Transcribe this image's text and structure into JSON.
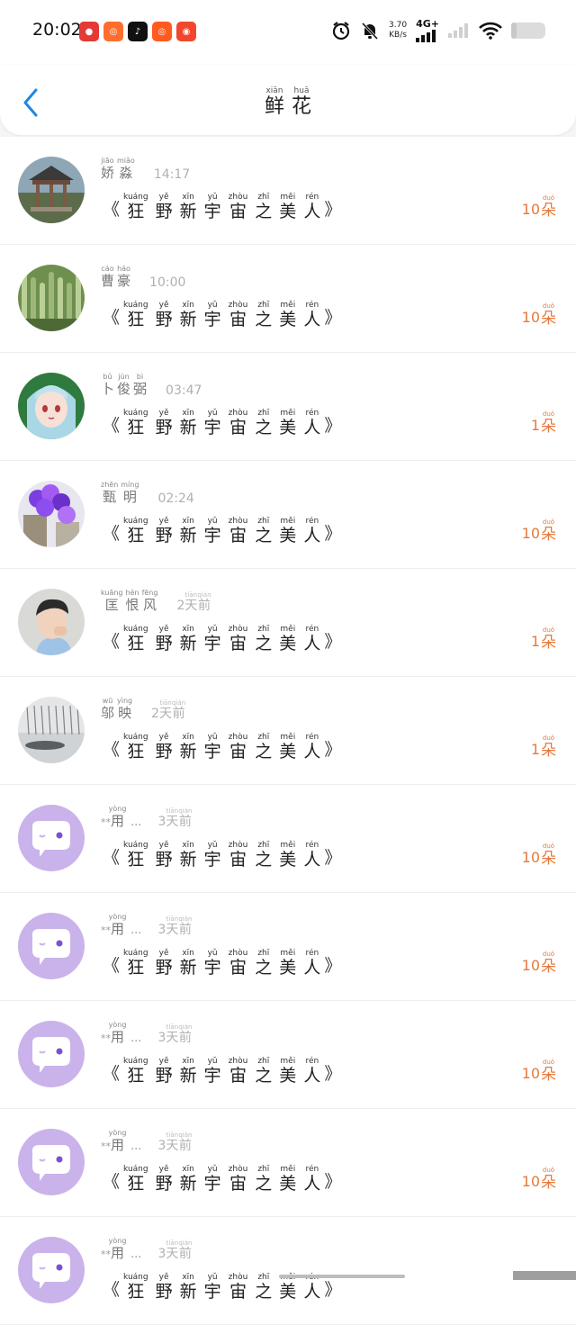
{
  "status": {
    "time": "20:02",
    "net_speed_top": "3.70",
    "net_speed_bottom": "KB/s",
    "network": "4G+",
    "battery_level": 0.15
  },
  "header": {
    "title": [
      {
        "char": "鲜",
        "py": "xiān"
      },
      {
        "char": "花",
        "py": "huā"
      }
    ]
  },
  "colors": {
    "accent": "#1e88e5",
    "count": "#e67a3c",
    "avatar_default": "#c9b3ea"
  },
  "message_prefix": "《",
  "message_suffix": "》",
  "message": [
    {
      "char": "狂",
      "py": "kuáng"
    },
    {
      "char": "野",
      "py": "yě"
    },
    {
      "char": "新",
      "py": "xīn"
    },
    {
      "char": "宇",
      "py": "yǔ"
    },
    {
      "char": "宙",
      "py": "zhòu"
    },
    {
      "char": "之",
      "py": "zhī"
    },
    {
      "char": "美",
      "py": "měi"
    },
    {
      "char": "人",
      "py": "rén"
    }
  ],
  "unit": {
    "char": "朵",
    "py": "duǒ"
  },
  "items": [
    {
      "avatar": "pavilion",
      "name": [
        {
          "char": "娇",
          "py": "jiāo"
        },
        {
          "char": "淼",
          "py": "miǎo"
        }
      ],
      "time_text": "14:17",
      "count": "10"
    },
    {
      "avatar": "cactus",
      "name": [
        {
          "char": "曹",
          "py": "cáo"
        },
        {
          "char": "豪",
          "py": "háo"
        }
      ],
      "time_text": "10:00",
      "count": "10"
    },
    {
      "avatar": "anime",
      "name": [
        {
          "char": "卜",
          "py": "bǔ"
        },
        {
          "char": "俊",
          "py": "jùn"
        },
        {
          "char": "弼",
          "py": "bì"
        }
      ],
      "time_text": "03:47",
      "count": "1"
    },
    {
      "avatar": "flowers",
      "name": [
        {
          "char": "甄",
          "py": "zhēn"
        },
        {
          "char": "明",
          "py": "míng"
        }
      ],
      "time_text": "02:24",
      "count": "10"
    },
    {
      "avatar": "person",
      "name": [
        {
          "char": "匡",
          "py": "kuāng"
        },
        {
          "char": "恨",
          "py": "hèn"
        },
        {
          "char": "风",
          "py": "fēng"
        }
      ],
      "time_num": "2",
      "time_text": "",
      "time_ago": [
        {
          "char": "天",
          "py": "tiān"
        },
        {
          "char": "前",
          "py": "qián"
        }
      ],
      "count": "1"
    },
    {
      "avatar": "snow",
      "name": [
        {
          "char": "邬",
          "py": "wū"
        },
        {
          "char": "映",
          "py": "yìng"
        }
      ],
      "time_num": "2",
      "time_text": "",
      "time_ago": [
        {
          "char": "天",
          "py": "tiān"
        },
        {
          "char": "前",
          "py": "qián"
        }
      ],
      "count": "1"
    },
    {
      "avatar": "default",
      "name_prefix": "**",
      "name": [
        {
          "char": "用",
          "py": "yòng"
        }
      ],
      "name_suffix": "...",
      "time_num": "3",
      "time_text": "",
      "time_ago": [
        {
          "char": "天",
          "py": "tiān"
        },
        {
          "char": "前",
          "py": "qián"
        }
      ],
      "count": "10"
    },
    {
      "avatar": "default",
      "name_prefix": "**",
      "name": [
        {
          "char": "用",
          "py": "yòng"
        }
      ],
      "name_suffix": "...",
      "time_num": "3",
      "time_text": "",
      "time_ago": [
        {
          "char": "天",
          "py": "tiān"
        },
        {
          "char": "前",
          "py": "qián"
        }
      ],
      "count": "10"
    },
    {
      "avatar": "default",
      "name_prefix": "**",
      "name": [
        {
          "char": "用",
          "py": "yòng"
        }
      ],
      "name_suffix": "...",
      "time_num": "3",
      "time_text": "",
      "time_ago": [
        {
          "char": "天",
          "py": "tiān"
        },
        {
          "char": "前",
          "py": "qián"
        }
      ],
      "count": "10"
    },
    {
      "avatar": "default",
      "name_prefix": "**",
      "name": [
        {
          "char": "用",
          "py": "yòng"
        }
      ],
      "name_suffix": "...",
      "time_num": "3",
      "time_text": "",
      "time_ago": [
        {
          "char": "天",
          "py": "tiān"
        },
        {
          "char": "前",
          "py": "qián"
        }
      ],
      "count": "10"
    },
    {
      "avatar": "default",
      "name_prefix": "**",
      "name": [
        {
          "char": "用",
          "py": "yòng"
        }
      ],
      "name_suffix": "...",
      "time_num": "3",
      "time_text": "",
      "time_ago": [
        {
          "char": "天",
          "py": "tiān"
        },
        {
          "char": "前",
          "py": "qián"
        }
      ],
      "count": ""
    }
  ]
}
